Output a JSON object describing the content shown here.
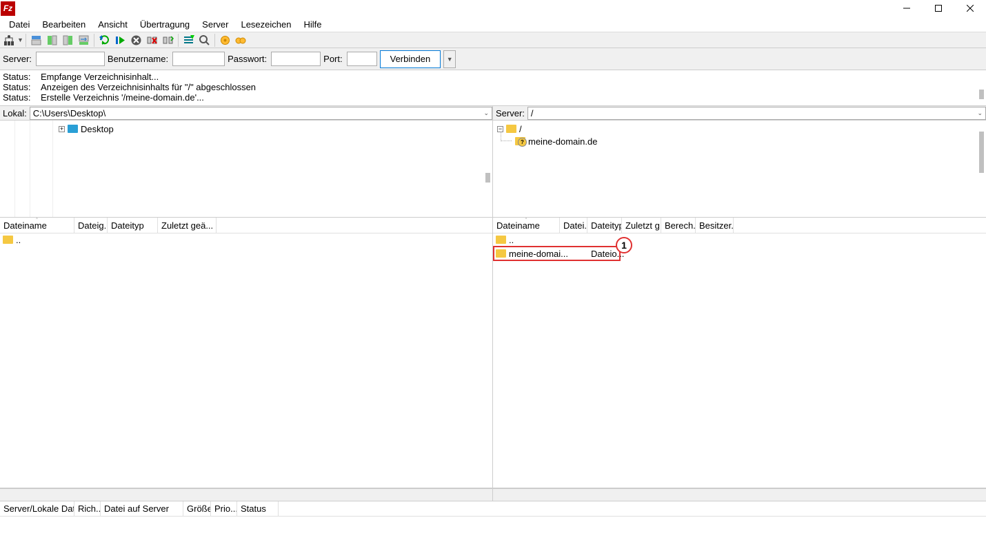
{
  "menu": [
    "Datei",
    "Bearbeiten",
    "Ansicht",
    "Übertragung",
    "Server",
    "Lesezeichen",
    "Hilfe"
  ],
  "quickbar": {
    "server_label": "Server:",
    "user_label": "Benutzername:",
    "pass_label": "Passwort:",
    "port_label": "Port:",
    "connect": "Verbinden"
  },
  "log": [
    {
      "label": "Status:",
      "msg": "Empfange Verzeichnisinhalt..."
    },
    {
      "label": "Status:",
      "msg": "Anzeigen des Verzeichnisinhalts für \"/\" abgeschlossen"
    },
    {
      "label": "Status:",
      "msg": "Erstelle Verzeichnis '/meine-domain.de'..."
    }
  ],
  "local": {
    "label": "Lokal:",
    "path": "C:\\Users\\Desktop\\",
    "tree_item": "Desktop",
    "cols": [
      "Dateiname",
      "Dateig...",
      "Dateityp",
      "Zuletzt geä..."
    ],
    "rows": [
      {
        "name": ".."
      }
    ]
  },
  "remote": {
    "label": "Server:",
    "path": "/",
    "tree_root": "/",
    "tree_child": "meine-domain.de",
    "cols": [
      "Dateiname",
      "Datei...",
      "Dateityp",
      "Zuletzt g...",
      "Berech...",
      "Besitzer..."
    ],
    "rows": [
      {
        "name": "..",
        "size": "",
        "type": "",
        "mod": "",
        "perm": "",
        "owner": ""
      },
      {
        "name": "meine-domai...",
        "size": "",
        "type": "Dateio...",
        "mod": "",
        "perm": "",
        "owner": "",
        "highlighted": true
      }
    ],
    "callout": "1"
  },
  "queue_cols": [
    "Server/Lokale Datei",
    "Rich...",
    "Datei auf Server",
    "Größe",
    "Prio...",
    "Status"
  ]
}
